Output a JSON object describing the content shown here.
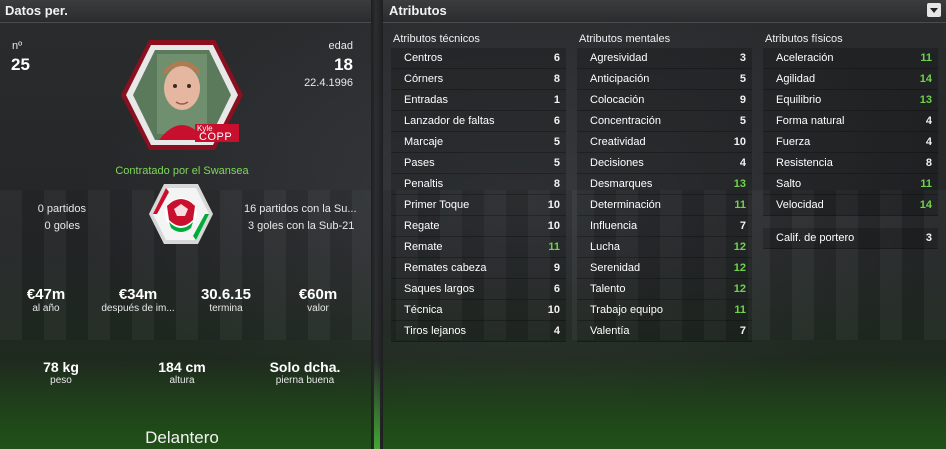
{
  "left": {
    "header": "Datos per.",
    "number_label": "nº",
    "number": "25",
    "age_label": "edad",
    "age": "18",
    "birthdate": "22.4.1996",
    "photo_caption_first": "Kyle",
    "photo_caption_last": "COPP",
    "status": "Contratado por el Swansea",
    "caps_matches": "0 partidos",
    "caps_goals": "0 goles",
    "youth_matches": "16 partidos con la Su...",
    "youth_goals": "3 goles con la Sub-21",
    "finance": [
      {
        "value": "€47m",
        "label": "al año"
      },
      {
        "value": "€34m",
        "label": "después de im..."
      },
      {
        "value": "30.6.15",
        "label": "termina"
      },
      {
        "value": "€60m",
        "label": "valor"
      }
    ],
    "physical": [
      {
        "value": "78 kg",
        "label": "peso"
      },
      {
        "value": "184 cm",
        "label": "altura"
      },
      {
        "value": "Solo dcha.",
        "label": "pierna buena"
      }
    ],
    "position": "Delantero"
  },
  "right": {
    "header": "Atributos",
    "technical": {
      "title": "Atributos técnicos",
      "items": [
        {
          "name": "Centros",
          "value": "6"
        },
        {
          "name": "Córners",
          "value": "8"
        },
        {
          "name": "Entradas",
          "value": "1"
        },
        {
          "name": "Lanzador de faltas",
          "value": "6"
        },
        {
          "name": "Marcaje",
          "value": "5"
        },
        {
          "name": "Pases",
          "value": "5"
        },
        {
          "name": "Penaltis",
          "value": "8"
        },
        {
          "name": "Primer Toque",
          "value": "10"
        },
        {
          "name": "Regate",
          "value": "10"
        },
        {
          "name": "Remate",
          "value": "11"
        },
        {
          "name": "Remates cabeza",
          "value": "9"
        },
        {
          "name": "Saques largos",
          "value": "6"
        },
        {
          "name": "Técnica",
          "value": "10"
        },
        {
          "name": "Tiros lejanos",
          "value": "4"
        }
      ]
    },
    "mental": {
      "title": "Atributos mentales",
      "items": [
        {
          "name": "Agresividad",
          "value": "3"
        },
        {
          "name": "Anticipación",
          "value": "5"
        },
        {
          "name": "Colocación",
          "value": "9"
        },
        {
          "name": "Concentración",
          "value": "5"
        },
        {
          "name": "Creatividad",
          "value": "10"
        },
        {
          "name": "Decisiones",
          "value": "4"
        },
        {
          "name": "Desmarques",
          "value": "13"
        },
        {
          "name": "Determinación",
          "value": "11"
        },
        {
          "name": "Influencia",
          "value": "7"
        },
        {
          "name": "Lucha",
          "value": "12"
        },
        {
          "name": "Serenidad",
          "value": "12"
        },
        {
          "name": "Talento",
          "value": "12"
        },
        {
          "name": "Trabajo equipo",
          "value": "11"
        },
        {
          "name": "Valentía",
          "value": "7"
        }
      ]
    },
    "physical": {
      "title": "Atributos físicos",
      "items": [
        {
          "name": "Aceleración",
          "value": "11"
        },
        {
          "name": "Agilidad",
          "value": "14"
        },
        {
          "name": "Equilibrio",
          "value": "13"
        },
        {
          "name": "Forma natural",
          "value": "4"
        },
        {
          "name": "Fuerza",
          "value": "4"
        },
        {
          "name": "Resistencia",
          "value": "8"
        },
        {
          "name": "Salto",
          "value": "11"
        },
        {
          "name": "Velocidad",
          "value": "14"
        }
      ],
      "goalkeeper": {
        "name": "Calif. de portero",
        "value": "3"
      }
    }
  },
  "colors": {
    "highlight": "#6fd44a",
    "wales_red": "#c8102e",
    "wales_green": "#00ab39"
  }
}
